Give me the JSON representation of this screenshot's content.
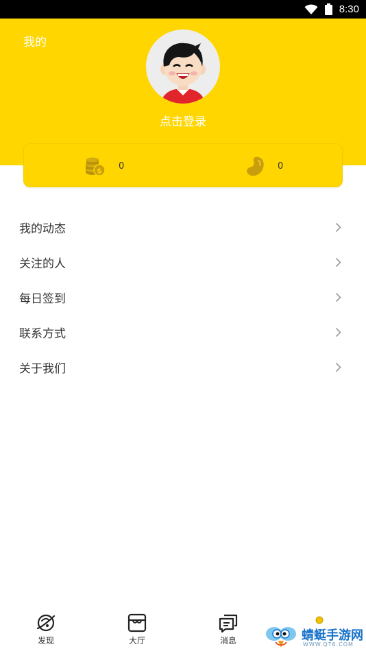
{
  "status_bar": {
    "time": "8:30",
    "icons": [
      "wifi-icon",
      "battery-icon"
    ]
  },
  "header": {
    "title": "我的",
    "login_prompt": "点击登录",
    "background_color": "#FFD600"
  },
  "stats": {
    "coins": {
      "icon": "coin-stack-icon",
      "value": "0"
    },
    "beans": {
      "icon": "bean-icon",
      "value": "0"
    }
  },
  "menu": {
    "items": [
      {
        "label": "我的动态"
      },
      {
        "label": "关注的人"
      },
      {
        "label": "每日签到"
      },
      {
        "label": "联系方式"
      },
      {
        "label": "关于我们"
      }
    ]
  },
  "tabbar": {
    "tabs": [
      {
        "label": "发现",
        "icon": "planet-icon"
      },
      {
        "label": "大厅",
        "icon": "store-icon"
      },
      {
        "label": "消息",
        "icon": "chat-icon"
      }
    ]
  },
  "watermark": {
    "text": "蜻蜓手游网",
    "url": "WWW.QT6.COM"
  }
}
